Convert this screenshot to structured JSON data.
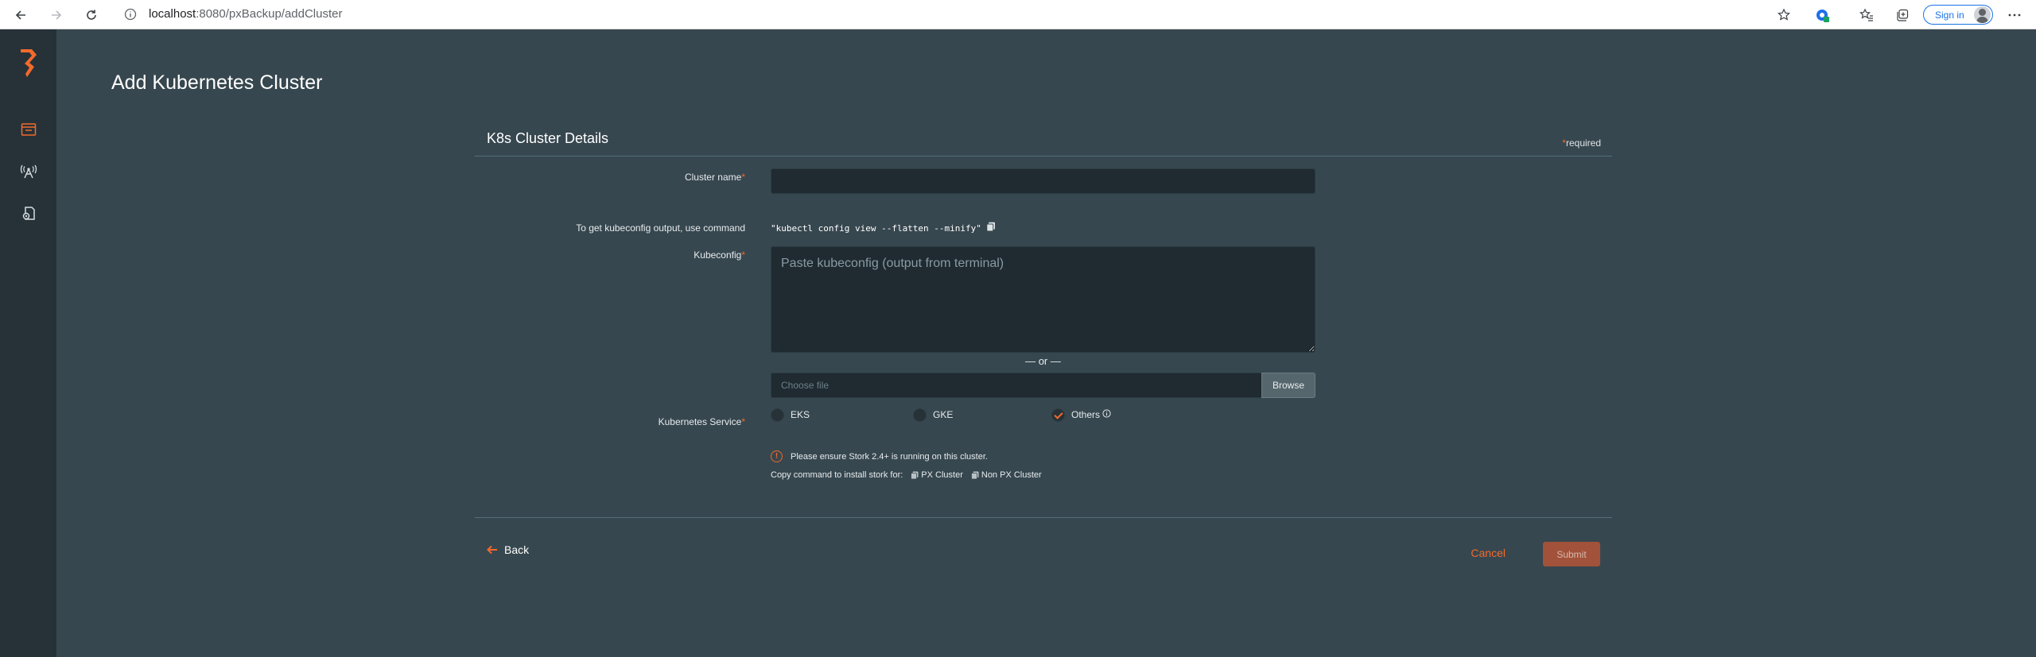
{
  "browser": {
    "url_host": "localhost",
    "url_path": ":8080/pxBackup/addCluster",
    "sign_in_label": "Sign in"
  },
  "sidebar": {
    "items": [
      {
        "icon": "portworx-logo"
      },
      {
        "icon": "backup-icon"
      },
      {
        "icon": "antenna-icon"
      },
      {
        "icon": "settings-doc-icon"
      }
    ]
  },
  "page": {
    "title": "Add Kubernetes Cluster"
  },
  "card": {
    "title": "K8s Cluster Details",
    "required_star": "*",
    "required_text": "required"
  },
  "form": {
    "cluster_name_label": "Cluster name",
    "cluster_name_value": "",
    "kubeconfig_hint_label": "To get kubeconfig output, use command",
    "kubeconfig_command": "\"kubectl config view --flatten --minify\"",
    "kubeconfig_label": "Kubeconfig",
    "kubeconfig_placeholder": "Paste kubeconfig (output from terminal)",
    "or_text": "— or —",
    "file_placeholder": "Choose file",
    "browse_label": "Browse",
    "k8s_service_label": "Kubernetes Service",
    "services": [
      {
        "label": "EKS",
        "selected": false
      },
      {
        "label": "GKE",
        "selected": false
      },
      {
        "label": "Others",
        "selected": true
      }
    ],
    "stork_warning": "Please ensure Stork 2.4+ is running on this cluster.",
    "copy_command_text": "Copy command to install stork for:",
    "px_cluster_label": "PX Cluster",
    "non_px_cluster_label": "Non PX Cluster"
  },
  "actions": {
    "back_label": "Back",
    "cancel_label": "Cancel",
    "submit_label": "Submit"
  },
  "colors": {
    "accent": "#f26a2c",
    "background": "#37474f",
    "sidebar": "#263238",
    "input_bg": "#1f2b31"
  }
}
